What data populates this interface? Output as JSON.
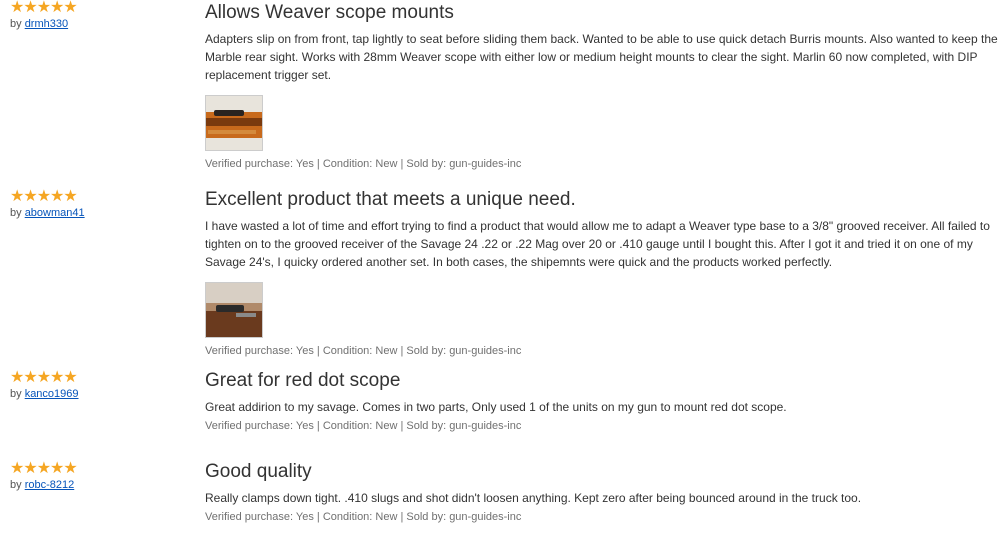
{
  "reviews": [
    {
      "stars": 5,
      "by_prefix": "by",
      "author": "drmh330",
      "title": "Allows Weaver scope mounts",
      "body": "Adapters slip on from front, tap lightly to seat before sliding them back. Wanted to be able to use quick detach Burris mounts. Also wanted to keep the Marble rear sight. Works with 28mm Weaver scope with either low or medium height mounts to clear the sight. Marlin 60 now completed, with DIP replacement trigger set.",
      "has_image": true,
      "footer": "Verified purchase: Yes | Condition: New | Sold by: gun-guides-inc"
    },
    {
      "stars": 5,
      "by_prefix": "by",
      "author": "abowman41",
      "title": "Excellent product that meets a unique need.",
      "body": "I have wasted a lot of time and effort trying to find a product that would allow me to adapt a Weaver type base to a 3/8\" grooved receiver. All failed to tighten on to the grooved receiver of the Savage 24 .22 or .22 Mag over 20 or .410 gauge until I bought this. After I got it and tried it on one of my Savage 24's, I quicky ordered another set. In both cases, the shipemnts were quick and the products worked perfectly.",
      "has_image": true,
      "footer": "Verified purchase: Yes | Condition: New | Sold by: gun-guides-inc"
    },
    {
      "stars": 5,
      "by_prefix": "by",
      "author": "kanco1969",
      "title": "Great for red dot scope",
      "body": "Great addirion to my savage.  Comes in two parts,  Only used 1 of the units on my gun to mount red dot scope.",
      "has_image": false,
      "footer": "Verified purchase: Yes | Condition: New | Sold by: gun-guides-inc"
    },
    {
      "stars": 5,
      "by_prefix": "by",
      "author": "robc-8212",
      "title": "Good quality",
      "body": "Really clamps down tight. .410 slugs and shot didn't loosen anything. Kept zero after being bounced around in the truck too.",
      "has_image": false,
      "footer": "Verified purchase: Yes | Condition: New | Sold by: gun-guides-inc"
    }
  ],
  "colors": {
    "star": "#f5a623",
    "link": "#0654ba"
  },
  "icons": {
    "star": "star-icon"
  }
}
